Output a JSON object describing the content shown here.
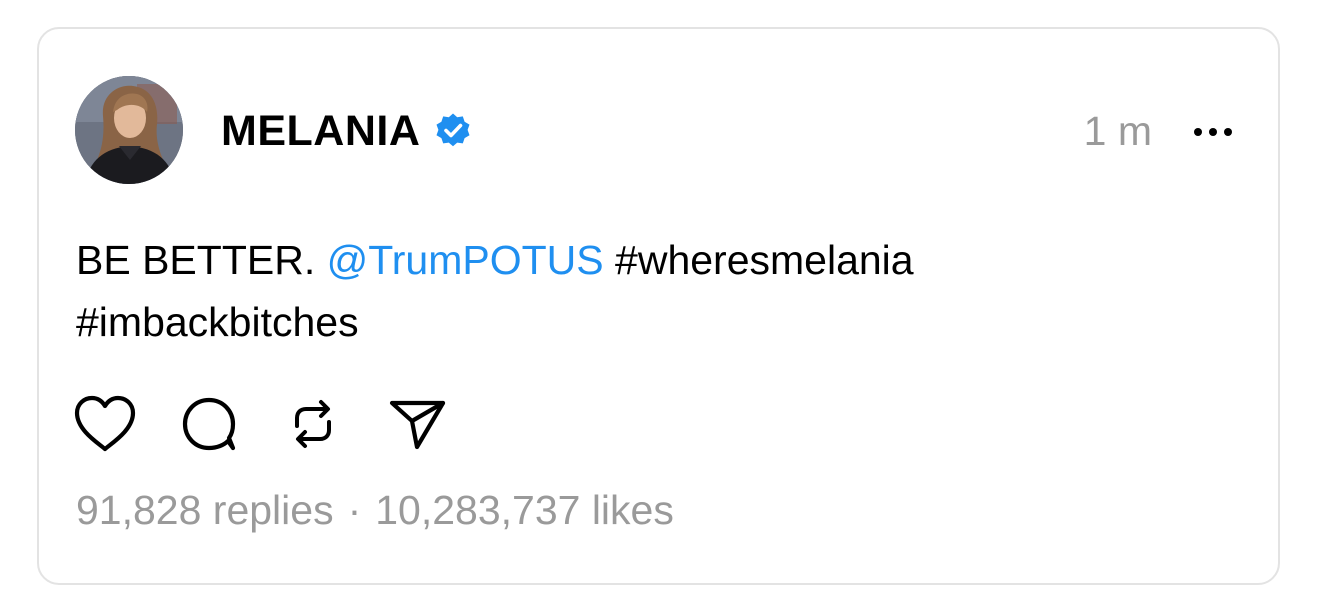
{
  "post": {
    "author": {
      "name": "MELANIA",
      "verified": true,
      "avatar": "profile-photo"
    },
    "timestamp": "1 m",
    "text": {
      "prefix": "BE BETTER.",
      "mention": "@TrumPOTUS",
      "hashtag_1": "#wheresmelania",
      "hashtag_2": "#imbackbitches"
    },
    "actions": [
      "heart-icon",
      "comment-icon",
      "repost-icon",
      "share-icon"
    ],
    "stats": {
      "replies": "91,828 replies",
      "separator": "·",
      "likes": "10,283,737 likes"
    }
  },
  "colors": {
    "mention": "#1f8ff0",
    "verified_badge": "#1f8ff0",
    "muted_text": "#9a9a9a",
    "border": "#e3e3e3"
  }
}
